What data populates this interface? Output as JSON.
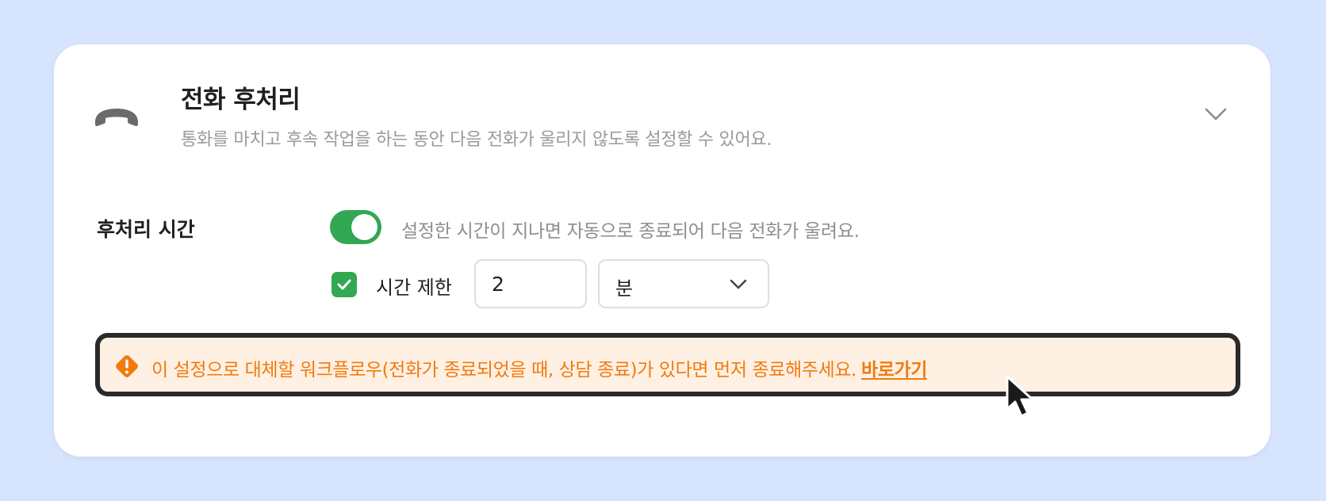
{
  "header": {
    "title": "전화 후처리",
    "subtitle": "통화를 마치고 후속 작업을 하는 동안 다음 전화가 울리지 않도록 설정할 수 있어요.",
    "icon": "phone-hangup-icon",
    "expand_icon": "chevron-down-icon"
  },
  "setting": {
    "label": "후처리 시간",
    "toggle_on": true,
    "toggle_description": "설정한 시간이 지나면 자동으로 종료되어 다음 전화가 울려요.",
    "time_limit": {
      "checked": true,
      "label": "시간 제한",
      "value": "2",
      "unit": "분"
    }
  },
  "alert": {
    "icon": "warning-icon",
    "message": "이 설정으로 대체할 워크플로우(전화가 종료되었을 때, 상담 종료)가 있다면 먼저 종료해주세요.",
    "link_label": "바로가기"
  },
  "colors": {
    "background": "#d7e4fd",
    "accent_green": "#32a852",
    "alert_orange": "#f27a0c",
    "alert_background": "#fff0e4"
  }
}
